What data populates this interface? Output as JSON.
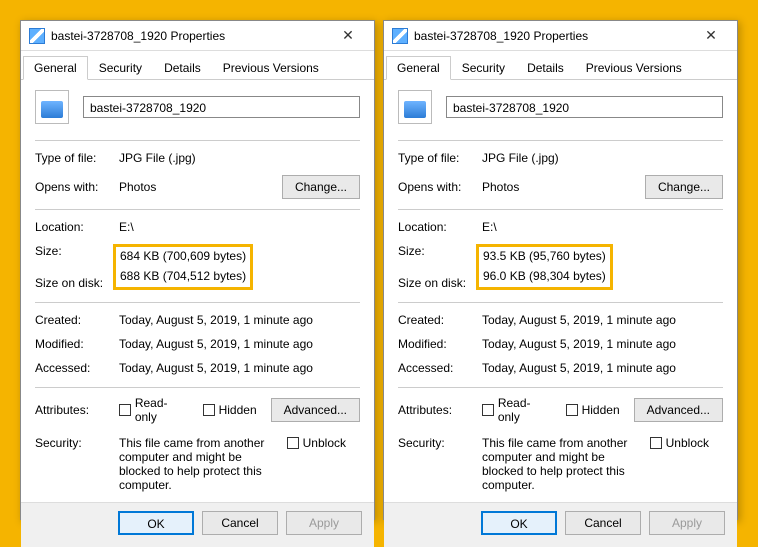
{
  "dialogs": [
    {
      "title": "bastei-3728708_1920 Properties",
      "tabs": [
        "General",
        "Security",
        "Details",
        "Previous Versions"
      ],
      "filename": "bastei-3728708_1920",
      "typeLabel": "Type of file:",
      "typeValue": "JPG File (.jpg)",
      "opensLabel": "Opens with:",
      "opensValue": "Photos",
      "changeBtn": "Change...",
      "locationLabel": "Location:",
      "locationValue": "E:\\",
      "sizeLabel": "Size:",
      "sizeValue": "684 KB (700,609 bytes)",
      "sizeDiskLabel": "Size on disk:",
      "sizeDiskValue": "688 KB (704,512 bytes)",
      "createdLabel": "Created:",
      "createdValue": "Today, August 5, 2019, 1 minute ago",
      "modifiedLabel": "Modified:",
      "modifiedValue": "Today, August 5, 2019, 1 minute ago",
      "accessedLabel": "Accessed:",
      "accessedValue": "Today, August 5, 2019, 1 minute ago",
      "attrLabel": "Attributes:",
      "readonly": "Read-only",
      "hidden": "Hidden",
      "advancedBtn": "Advanced...",
      "secLabel": "Security:",
      "secText": "This file came from another computer and might be blocked to help protect this computer.",
      "unblock": "Unblock",
      "ok": "OK",
      "cancel": "Cancel",
      "apply": "Apply"
    },
    {
      "title": "bastei-3728708_1920 Properties",
      "tabs": [
        "General",
        "Security",
        "Details",
        "Previous Versions"
      ],
      "filename": "bastei-3728708_1920",
      "typeLabel": "Type of file:",
      "typeValue": "JPG File (.jpg)",
      "opensLabel": "Opens with:",
      "opensValue": "Photos",
      "changeBtn": "Change...",
      "locationLabel": "Location:",
      "locationValue": "E:\\",
      "sizeLabel": "Size:",
      "sizeValue": "93.5 KB (95,760 bytes)",
      "sizeDiskLabel": "Size on disk:",
      "sizeDiskValue": "96.0 KB (98,304 bytes)",
      "createdLabel": "Created:",
      "createdValue": "Today, August 5, 2019, 1 minute ago",
      "modifiedLabel": "Modified:",
      "modifiedValue": "Today, August 5, 2019, 1 minute ago",
      "accessedLabel": "Accessed:",
      "accessedValue": "Today, August 5, 2019, 1 minute ago",
      "attrLabel": "Attributes:",
      "readonly": "Read-only",
      "hidden": "Hidden",
      "advancedBtn": "Advanced...",
      "secLabel": "Security:",
      "secText": "This file came from another computer and might be blocked to help protect this computer.",
      "unblock": "Unblock",
      "ok": "OK",
      "cancel": "Cancel",
      "apply": "Apply"
    }
  ]
}
